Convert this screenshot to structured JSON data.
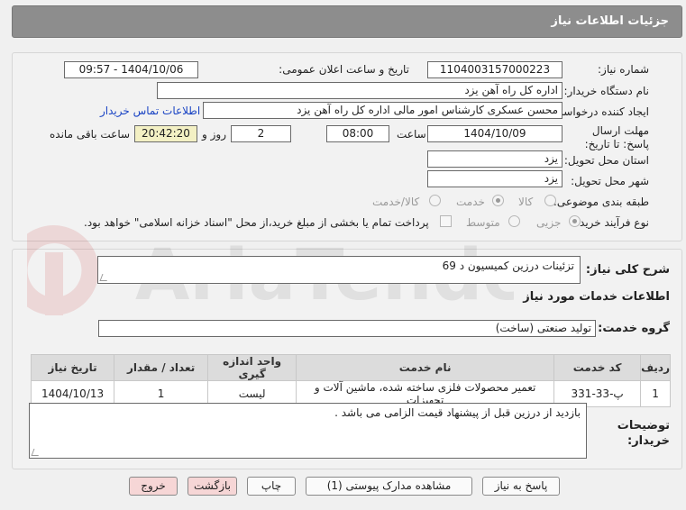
{
  "header": {
    "title": "جزئیات اطلاعات نیاز"
  },
  "form": {
    "need_number_label": "شماره نیاز:",
    "need_number": "1104003157000223",
    "announce_label": "تاریخ و ساعت اعلان عمومی:",
    "announce_value": "1404/10/06 - 09:57",
    "buyer_label": "نام دستگاه خریدار:",
    "buyer": "اداره کل راه آهن یزد",
    "creator_label": "ایجاد کننده درخواست:",
    "creator": "محسن عسکری کارشناس امور مالی اداره کل راه آهن یزد",
    "contact_link": "اطلاعات تماس خریدار",
    "deadline_label": "مهلت ارسال پاسخ: تا تاریخ:",
    "deadline_date": "1404/10/09",
    "time_label": "ساعت",
    "deadline_time": "08:00",
    "days_value": "2",
    "days_label": "روز و",
    "remaining_time": "20:42:20",
    "remaining_label": "ساعت باقی مانده",
    "province_label": "استان محل تحویل:",
    "province": "یزد",
    "city_label": "شهر محل تحویل:",
    "city": "یزد",
    "category_label": "طبقه بندی موضوعی:",
    "category_options": [
      "کالا",
      "خدمت",
      "کالا/خدمت"
    ],
    "category_selected": "خدمت",
    "process_label": "نوع فرآیند خرید :",
    "process_options": [
      "جزیی",
      "متوسط"
    ],
    "process_selected": "جزیی",
    "treasury_text": "پرداخت تمام یا بخشی از مبلغ خرید،از محل \"اسناد خزانه اسلامی\" خواهد بود."
  },
  "description": {
    "label": "شرح کلی نیاز:",
    "value": "تزئینات درزین کمیسیون د 69"
  },
  "services": {
    "section_title": "اطلاعات خدمات مورد نیاز",
    "group_label": "گروه خدمت:",
    "group_value": "تولید صنعتی (ساخت)",
    "columns": [
      "ردیف",
      "کد خدمت",
      "نام خدمت",
      "واحد اندازه گیری",
      "تعداد / مقدار",
      "تاریخ نیاز"
    ],
    "rows": [
      [
        "1",
        "پ-33-331",
        "تعمیر محصولات فلزی ساخته شده، ماشین آلات و تجهیزات",
        "لیست",
        "1",
        "1404/10/13"
      ]
    ]
  },
  "notes": {
    "label": "توضیحات خریدار:",
    "value": "بازدید از درزین قبل از پیشنهاد قیمت الزامی می باشد ."
  },
  "buttons": {
    "reply": "پاسخ به نیاز",
    "attachments": "مشاهده مدارک پیوستی (1)",
    "print": "چاپ",
    "back": "بازگشت",
    "exit": "خروج"
  },
  "watermark": {
    "text": "AriaTender.net"
  },
  "colors": {
    "header_bg": "#8d8d8d",
    "link": "#1a44c4",
    "remaining_bg": "#f3f0c4",
    "pink_button": "#f6d6d6"
  }
}
